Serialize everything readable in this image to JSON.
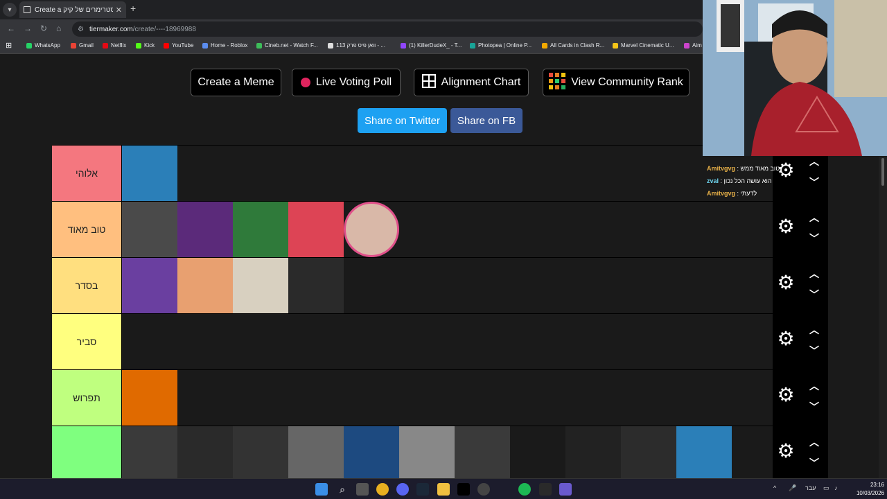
{
  "browser": {
    "tab_title": "Create a פירוג סטרימרים של קיק",
    "url_host": "tiermaker.com",
    "url_path": "/create/----18969988",
    "bookmarks": [
      {
        "label": "WhatsApp",
        "color": "#25d366"
      },
      {
        "label": "Gmail",
        "color": "#ea4335"
      },
      {
        "label": "Netflix",
        "color": "#e50914"
      },
      {
        "label": "Kick",
        "color": "#53fc18"
      },
      {
        "label": "YouTube",
        "color": "#ff0000"
      },
      {
        "label": "Home - Roblox",
        "color": "#5b8def"
      },
      {
        "label": "Cineb.net - Watch F...",
        "color": "#3dbd5a"
      },
      {
        "label": "וואן פיס פרק 113 - ...",
        "color": "#dddddd"
      },
      {
        "label": "(1) KillerDudeX_ - T...",
        "color": "#9146ff"
      },
      {
        "label": "Photopea | Online P...",
        "color": "#18a497"
      },
      {
        "label": "All Cards in Clash R...",
        "color": "#f2a900"
      },
      {
        "label": "Marvel Cinematic U...",
        "color": "#f5c518"
      },
      {
        "label": "Aim",
        "color": "#cc44cc"
      }
    ]
  },
  "toolbar": {
    "create_meme": "Create a Meme",
    "live_voting": "Live Voting Poll",
    "alignment": "Alignment Chart",
    "community": "View Community Rank",
    "share_twitter": "Share on Twitter",
    "share_fb": "Share on FB"
  },
  "tiers": [
    {
      "label": "אלוהי",
      "color": "#f4777f",
      "image_count": 1
    },
    {
      "label": "טוב מאוד",
      "color": "#ffbf7f",
      "image_count": 5
    },
    {
      "label": "בסדר",
      "color": "#ffdf7f",
      "image_count": 4
    },
    {
      "label": "סביר",
      "color": "#ffff7f",
      "image_count": 1
    },
    {
      "label": "תפרוש",
      "color": "#bfff7f",
      "image_count": 1
    },
    {
      "label": "",
      "color": "#7fff7f",
      "image_count": 11
    }
  ],
  "chat": [
    {
      "user": "Amitvgvg",
      "user_color": "#e7b048",
      "message": "טוב מאוד ממש"
    },
    {
      "user": "zval",
      "user_color": "#6fd6f0",
      "message": "הוא עושה הכל נכון"
    },
    {
      "user": "Amitvgvg",
      "user_color": "#e7b048",
      "message": "לדעתי"
    }
  ],
  "taskbar": {
    "language": "עבר",
    "time": "23:16",
    "date": "10/03/2026"
  }
}
